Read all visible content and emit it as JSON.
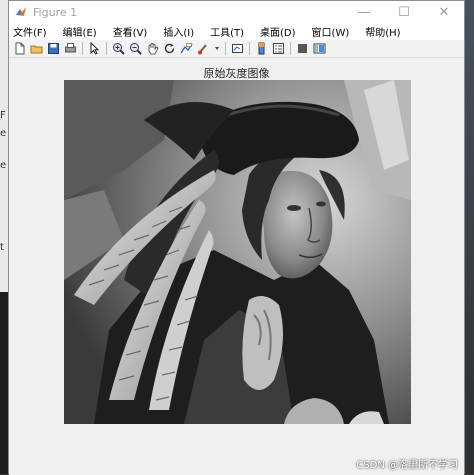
{
  "window": {
    "title": "Figure 1",
    "controls": {
      "minimize": "—",
      "maximize": "☐",
      "close": "✕"
    }
  },
  "menu": [
    "文件(F)",
    "编辑(E)",
    "查看(V)",
    "插入(I)",
    "工具(T)",
    "桌面(D)",
    "窗口(W)",
    "帮助(H)"
  ],
  "toolbar_icons": [
    "new-figure-icon",
    "open-file-icon",
    "save-icon",
    "print-icon",
    "edit-plot-arrow-icon",
    "zoom-in-icon",
    "zoom-out-icon",
    "pan-hand-icon",
    "rotate-3d-icon",
    "data-cursor-icon",
    "brush-icon",
    "link-plot-icon",
    "colorbar-icon",
    "legend-icon",
    "hide-plot-tools-icon",
    "show-plot-tools-icon"
  ],
  "axes": {
    "title": "原始灰度图像",
    "image_alt": "grayscale photo: man with feathered hat"
  },
  "watermark": "CSDN @洛里斯不学习",
  "background_fragments": [
    "e",
    "F",
    "t",
    "e"
  ]
}
